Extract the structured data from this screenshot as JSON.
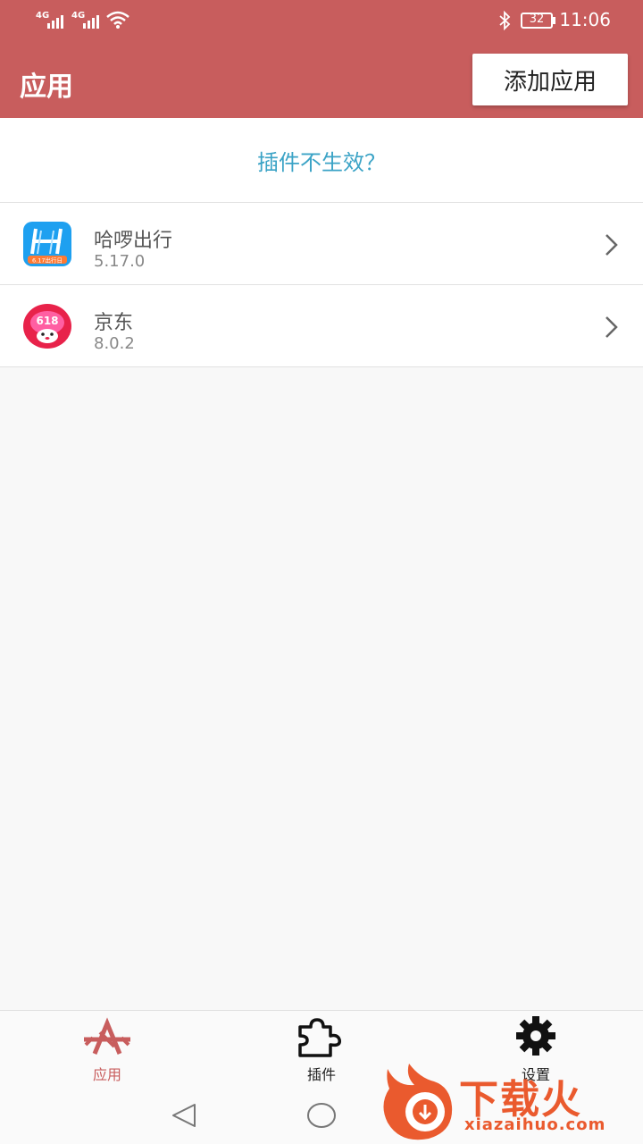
{
  "status_bar": {
    "network_1": "4G",
    "network_2": "4G",
    "battery": "32",
    "time": "11:06"
  },
  "app_bar": {
    "title": "应用",
    "add_button": "添加应用"
  },
  "plugin_hint": "插件不生效？",
  "apps": [
    {
      "name": "哈啰出行",
      "version": "5.17.0",
      "icon": "hellobike-icon",
      "icon_badge": "6.17出行日"
    },
    {
      "name": "京东",
      "version": "8.0.2",
      "icon": "jd-icon",
      "icon_badge": "618"
    }
  ],
  "bottom_nav": [
    {
      "label": "应用",
      "icon": "apps-icon",
      "active": true
    },
    {
      "label": "插件",
      "icon": "puzzle-icon",
      "active": false
    },
    {
      "label": "设置",
      "icon": "gear-icon",
      "active": false
    }
  ],
  "watermark": {
    "text": "下载火",
    "url": "xiazaihuo.com"
  },
  "colors": {
    "primary": "#c85d5d",
    "link": "#3ba3c6",
    "watermark": "#ea5a2e"
  }
}
